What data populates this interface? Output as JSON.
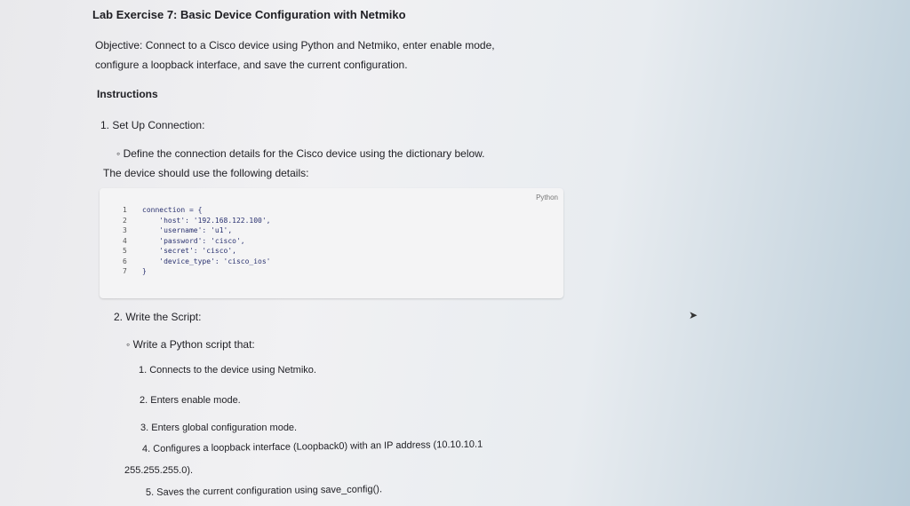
{
  "title": "Lab Exercise 7: Basic Device Configuration with Netmiko",
  "objective_line1": "Objective: Connect to a Cisco device using Python and Netmiko, enter enable mode,",
  "objective_line2": "configure a loopback interface, and save the current configuration.",
  "instructions_heading": "Instructions",
  "step1": {
    "heading": "1. Set Up Connection:",
    "bullet": "Define the connection details for the Cisco device using the dictionary below.",
    "note": "The device should use the following details:"
  },
  "code": {
    "language": "Python",
    "lines": [
      {
        "n": "1",
        "text": "connection = {"
      },
      {
        "n": "2",
        "text": "    'host': '192.168.122.100',"
      },
      {
        "n": "3",
        "text": "    'username': 'u1',"
      },
      {
        "n": "4",
        "text": "    'password': 'cisco',"
      },
      {
        "n": "5",
        "text": "    'secret': 'cisco',"
      },
      {
        "n": "6",
        "text": "    'device_type': 'cisco_ios'"
      },
      {
        "n": "7",
        "text": "}"
      }
    ]
  },
  "step2": {
    "heading": "2. Write the Script:",
    "bullet": "Write a Python script that:",
    "items": [
      "1. Connects to the device using Netmiko.",
      "2. Enters enable mode.",
      "3. Enters global configuration mode.",
      "4. Configures a loopback interface (Loopback0) with an IP address (10.10.10.1",
      "255.255.255.0).",
      "5. Saves the current configuration using save_config()."
    ]
  }
}
